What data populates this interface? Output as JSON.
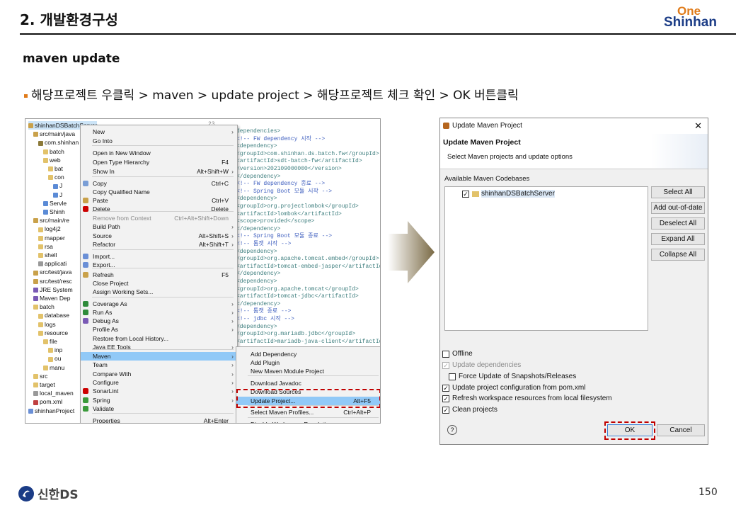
{
  "header": {
    "title": "2. 개발환경구성",
    "logo_top": "One",
    "logo_bottom": "Shinhan"
  },
  "section": {
    "title": "maven update",
    "bullet": "해당프로젝트 우클릭 > maven > update project > 해당프로젝트 체크 확인 > OK 버튼클릭"
  },
  "project_tree": [
    "shinhanDSBatchServer",
    "src/main/java",
    "com.shinhan",
    "batch",
    "web",
    "bat",
    "con",
    "J",
    "J",
    "Servle",
    "Shinh",
    "src/main/re",
    "log4j2",
    "mapper",
    "rsa",
    "shell",
    "applicati",
    "src/test/java",
    "src/test/resc",
    "JRE System",
    "Maven Dep",
    "batch",
    "database",
    "logs",
    "resource",
    "file",
    "inp",
    "ou",
    "manu",
    "src",
    "target",
    "local_maven",
    "pom.xml",
    "shinhanProject"
  ],
  "context_menu": [
    {
      "label": "New",
      "shortcut": "",
      "arrow": true
    },
    {
      "label": "Go Into",
      "shortcut": "",
      "arrow": false
    },
    {
      "label": "Open in New Window",
      "shortcut": "",
      "arrow": false
    },
    {
      "label": "Open Type Hierarchy",
      "shortcut": "F4",
      "arrow": false
    },
    {
      "label": "Show In",
      "shortcut": "Alt+Shift+W",
      "arrow": true
    },
    {
      "label": "Copy",
      "shortcut": "Ctrl+C",
      "arrow": false
    },
    {
      "label": "Copy Qualified Name",
      "shortcut": "",
      "arrow": false
    },
    {
      "label": "Paste",
      "shortcut": "Ctrl+V",
      "arrow": false
    },
    {
      "label": "Delete",
      "shortcut": "Delete",
      "arrow": false
    },
    {
      "label": "Remove from Context",
      "shortcut": "Ctrl+Alt+Shift+Down",
      "arrow": false
    },
    {
      "label": "Build Path",
      "shortcut": "",
      "arrow": true
    },
    {
      "label": "Source",
      "shortcut": "Alt+Shift+S",
      "arrow": true
    },
    {
      "label": "Refactor",
      "shortcut": "Alt+Shift+T",
      "arrow": true
    },
    {
      "label": "Import...",
      "shortcut": "",
      "arrow": false
    },
    {
      "label": "Export...",
      "shortcut": "",
      "arrow": false
    },
    {
      "label": "Refresh",
      "shortcut": "F5",
      "arrow": false
    },
    {
      "label": "Close Project",
      "shortcut": "",
      "arrow": false
    },
    {
      "label": "Assign Working Sets...",
      "shortcut": "",
      "arrow": false
    },
    {
      "label": "Coverage As",
      "shortcut": "",
      "arrow": true
    },
    {
      "label": "Run As",
      "shortcut": "",
      "arrow": true
    },
    {
      "label": "Debug As",
      "shortcut": "",
      "arrow": true
    },
    {
      "label": "Profile As",
      "shortcut": "",
      "arrow": true
    },
    {
      "label": "Restore from Local History...",
      "shortcut": "",
      "arrow": false
    },
    {
      "label": "Java EE Tools",
      "shortcut": "",
      "arrow": true
    },
    {
      "label": "Maven",
      "shortcut": "",
      "arrow": true
    },
    {
      "label": "Team",
      "shortcut": "",
      "arrow": true
    },
    {
      "label": "Compare With",
      "shortcut": "",
      "arrow": true
    },
    {
      "label": "Configure",
      "shortcut": "",
      "arrow": true
    },
    {
      "label": "SonarLint",
      "shortcut": "",
      "arrow": true
    },
    {
      "label": "Spring",
      "shortcut": "",
      "arrow": true
    },
    {
      "label": "Validate",
      "shortcut": "",
      "arrow": false
    },
    {
      "label": "Properties",
      "shortcut": "Alt+Enter",
      "arrow": false
    }
  ],
  "maven_submenu": [
    {
      "label": "Add Dependency",
      "shortcut": ""
    },
    {
      "label": "Add Plugin",
      "shortcut": ""
    },
    {
      "label": "New Maven Module Project",
      "shortcut": ""
    },
    {
      "label": "Download Javadoc",
      "shortcut": ""
    },
    {
      "label": "Download Sources",
      "shortcut": ""
    },
    {
      "label": "Update Project...",
      "shortcut": "Alt+F5"
    },
    {
      "label": "Select Maven Profiles...",
      "shortcut": "Ctrl+Alt+P"
    },
    {
      "label": "Disable Workspace Resolution",
      "shortcut": ""
    }
  ],
  "editor": {
    "line_no": "23",
    "lines": [
      "dependencies>",
      "  <!-- FW dependency 시작 -->",
      "  <dependency>",
      "    <groupId>com.shinhan.ds.batch.fw</groupId>",
      "    <artifactId>sdt-batch-fw</artifactId>",
      "    <version>202109000000</version>",
      "  </dependency>",
      "  <!-- FW dependency 종료 -->",
      "  <!-- Spring Boot 모듈 시작 -->",
      "  <dependency>",
      "    <groupId>org.projectlombok</groupId>",
      "    <artifactId>lombok</artifactId>",
      "    <scope>provided</scope>",
      "  </dependency>",
      "  <!-- Spring Boot 모듈 종료 -->",
      "  <!-- 톰캣 시작 -->",
      "  <dependency>",
      "    <groupId>org.apache.tomcat.embed</groupId>",
      "    <artifactId>tomcat-embed-jasper</artifactId>",
      "  </dependency>",
      "  <dependency>",
      "    <groupId>org.apache.tomcat</groupId>",
      "    <artifactId>tomcat-jdbc</artifactId>",
      "  </dependency>",
      "  <!-- 톰캣 종료 -->",
      "  <!-- jdbc 시작 -->",
      "  <dependency>",
      "    <groupId>org.mariadb.jdbc</groupId>",
      "    <artifactId>mariadb-java-client</artifactId>"
    ]
  },
  "dialog": {
    "title": "Update Maven Project",
    "heading": "Update Maven Project",
    "description": "Select Maven projects and update options",
    "codebases_label": "Available Maven Codebases",
    "project": "shinhanDSBatchServer",
    "buttons": {
      "select_all": "Select All",
      "add_out_of_date": "Add out-of-date",
      "deselect_all": "Deselect All",
      "expand_all": "Expand All",
      "collapse_all": "Collapse All",
      "ok": "OK",
      "cancel": "Cancel"
    },
    "options": {
      "offline": "Offline",
      "update_deps": "Update dependencies",
      "force_update": "Force Update of Snapshots/Releases",
      "update_config": "Update project configuration from pom.xml",
      "refresh_ws": "Refresh workspace resources from local filesystem",
      "clean": "Clean projects"
    },
    "help": "?"
  },
  "footer": {
    "brand": "신한DS",
    "page": "150"
  },
  "colors": {
    "accent_orange": "#e07b1a",
    "brand_blue": "#1b3c86",
    "highlight": "#c00000"
  }
}
